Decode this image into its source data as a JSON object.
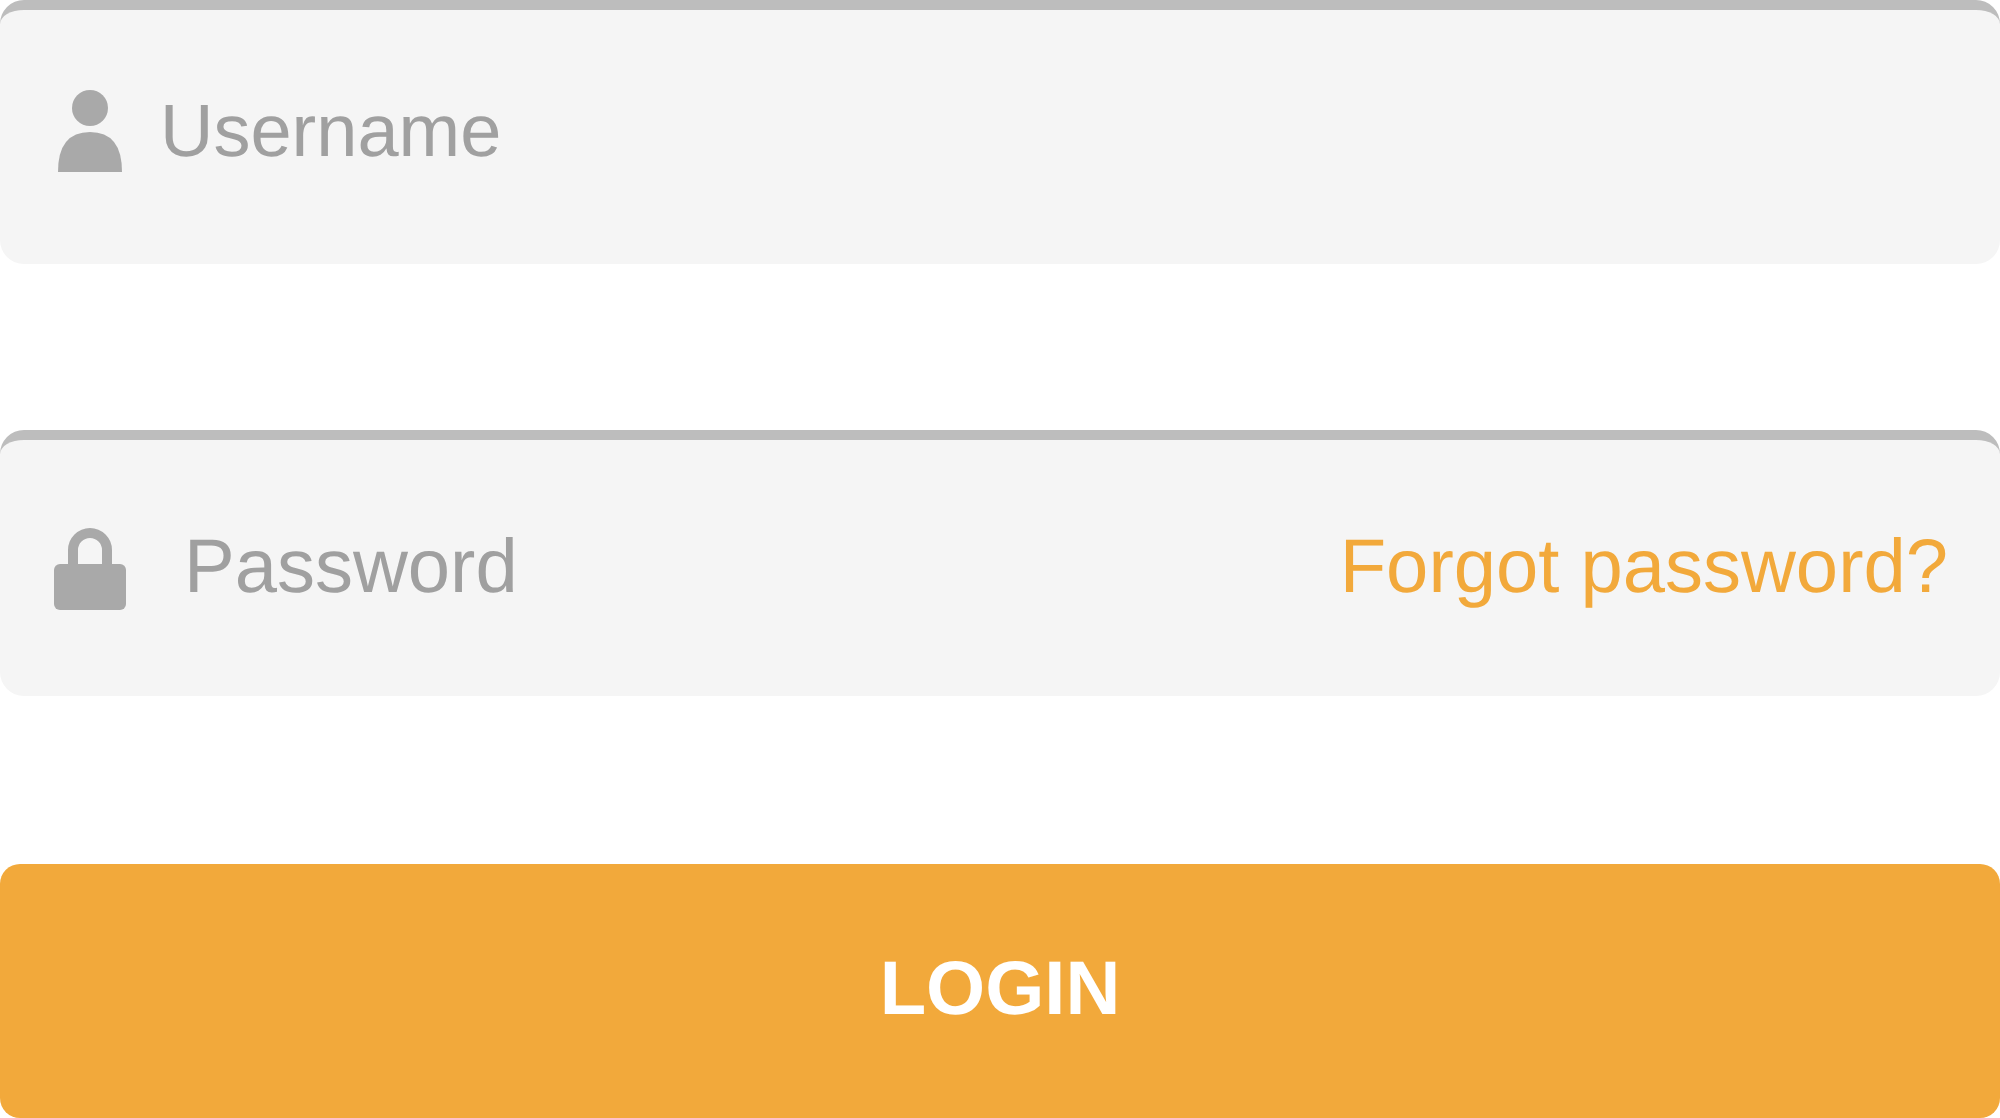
{
  "username": {
    "placeholder": "Username"
  },
  "password": {
    "placeholder": "Password",
    "forgot_link": "Forgot password?"
  },
  "login_button": {
    "label": "LOGIN"
  }
}
